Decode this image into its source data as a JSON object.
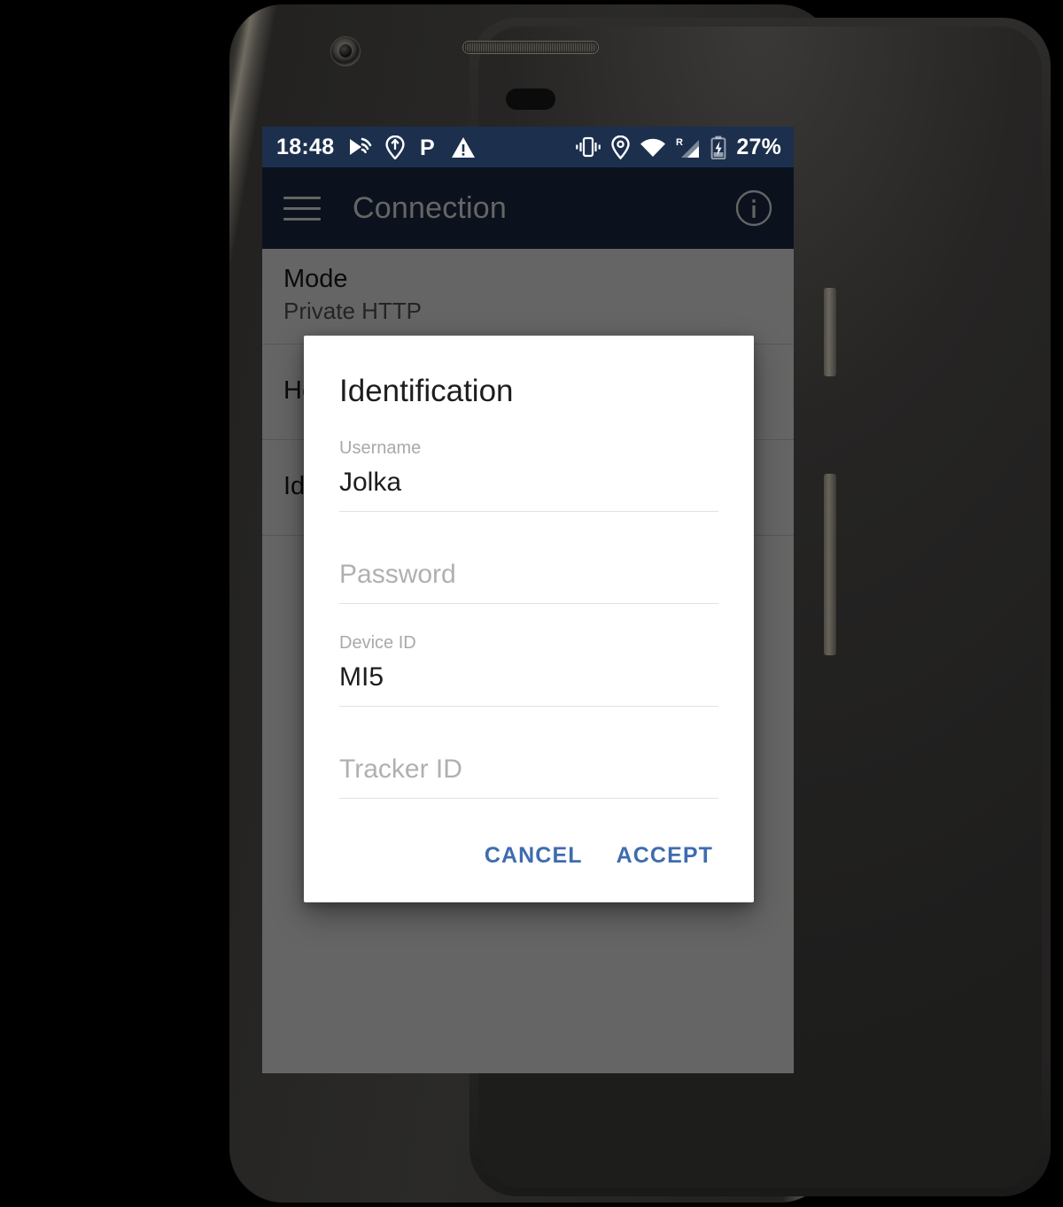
{
  "device": {
    "hardware": {
      "front_camera": "front-camera",
      "earpiece": "earpiece-speaker",
      "sensor": "proximity-sensor",
      "power_button": "power-button",
      "volume_rocker": "volume-rocker"
    }
  },
  "status_bar": {
    "clock": "18:48",
    "battery_percent": "27%",
    "left_icons": [
      "cast-icon",
      "location-share-icon",
      "parking-p-icon",
      "warning-triangle-icon"
    ],
    "right_icons": [
      "vibrate-icon",
      "location-pin-icon",
      "wifi-icon",
      "roaming-signal-icon",
      "battery-charging-icon"
    ],
    "background_color": "#1c2f4d"
  },
  "app_bar": {
    "menu_icon": "hamburger-menu-icon",
    "title": "Connection",
    "info_icon": "info-circle-icon",
    "background_color": "#1c2f4d"
  },
  "settings_list": [
    {
      "title": "Mode",
      "subtitle": "Private HTTP"
    },
    {
      "title": "Host",
      "subtitle": ""
    },
    {
      "title": "Identification",
      "subtitle": ""
    }
  ],
  "scrim": {
    "color": "#000000",
    "opacity": "0.605"
  },
  "dialog": {
    "title": "Identification",
    "fields": [
      {
        "label": "Username",
        "value": "Jolka",
        "placeholder": "Username",
        "has_value": true
      },
      {
        "label": "Password",
        "value": "",
        "placeholder": "Password",
        "has_value": false
      },
      {
        "label": "Device ID",
        "value": "MI5",
        "placeholder": "Device ID",
        "has_value": true
      },
      {
        "label": "Tracker ID",
        "value": "",
        "placeholder": "Tracker ID",
        "has_value": false
      }
    ],
    "actions": {
      "cancel_label": "CANCEL",
      "accept_label": "ACCEPT",
      "accent_color": "#3f6cb0"
    }
  }
}
